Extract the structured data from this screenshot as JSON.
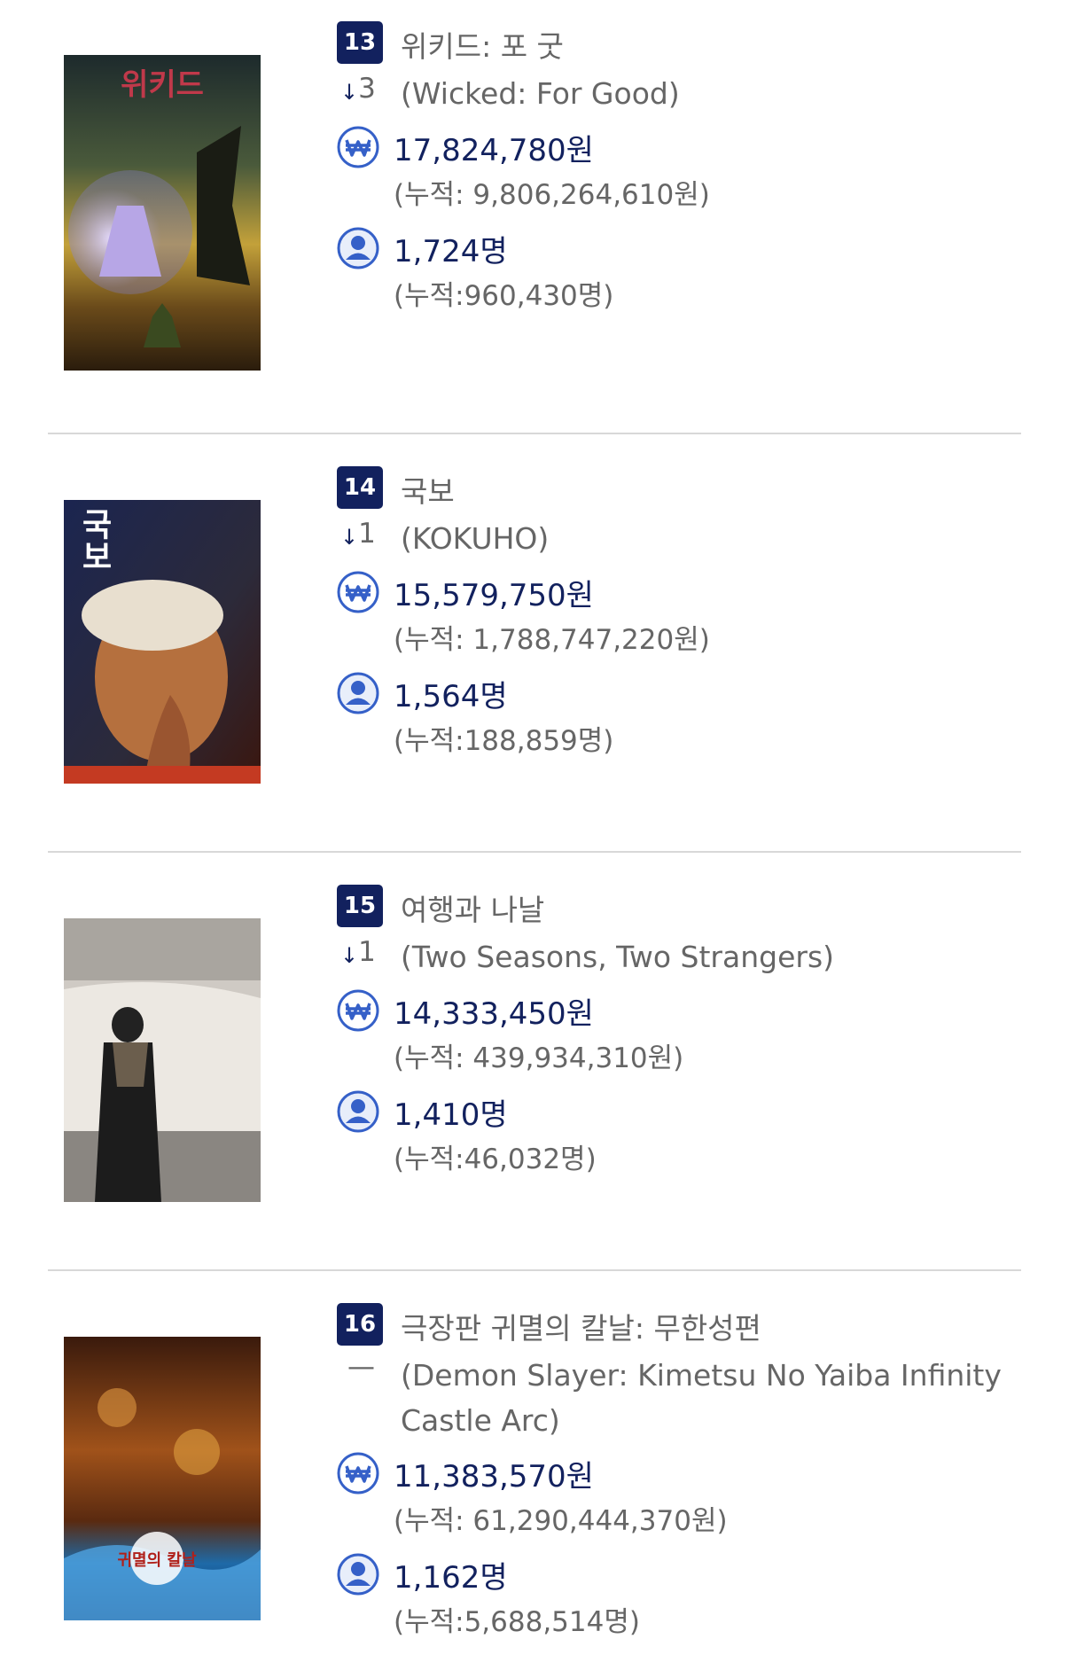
{
  "movies": [
    {
      "rank": "13",
      "title_ko": "위키드: 포 굿",
      "rank_change": "3",
      "rank_change_dir": "down",
      "title_en": "(Wicked: For Good)",
      "sales": "17,824,780원",
      "sales_cum": "(누적: 9,806,264,610원)",
      "audience": "1,724명",
      "audience_cum": "(누적:960,430명)",
      "poster_text": "위키드"
    },
    {
      "rank": "14",
      "title_ko": "국보",
      "rank_change": "1",
      "rank_change_dir": "down",
      "title_en": "(KOKUHO)",
      "sales": "15,579,750원",
      "sales_cum": "(누적: 1,788,747,220원)",
      "audience": "1,564명",
      "audience_cum": "(누적:188,859명)",
      "poster_text": "국보"
    },
    {
      "rank": "15",
      "title_ko": "여행과 나날",
      "rank_change": "1",
      "rank_change_dir": "down",
      "title_en": "(Two Seasons, Two Strangers)",
      "sales": "14,333,450원",
      "sales_cum": "(누적: 439,934,310원)",
      "audience": "1,410명",
      "audience_cum": "(누적:46,032명)",
      "poster_text": ""
    },
    {
      "rank": "16",
      "title_ko": "극장판 귀멸의 칼날: 무한성편",
      "rank_change": "—",
      "rank_change_dir": "same",
      "title_en": "(Demon Slayer: Kimetsu No Yaiba Infinity Castle Arc)",
      "sales": "11,383,570원",
      "sales_cum": "(누적: 61,290,444,370원)",
      "audience": "1,162명",
      "audience_cum": "(누적:5,688,514명)",
      "poster_text": "귀멸의 칼날"
    }
  ],
  "colors": {
    "navy": "#12215e",
    "icon_blue": "#3560c8",
    "text_gray": "#666666",
    "divider": "#d8d8d8"
  },
  "icons": {
    "arrow_down": "arrow-down-icon",
    "won": "won-icon",
    "person": "person-icon"
  }
}
